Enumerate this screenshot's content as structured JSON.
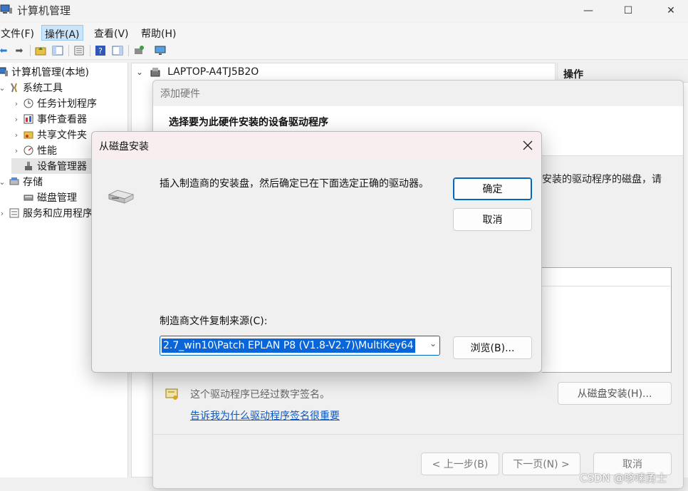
{
  "window": {
    "title": "计算机管理",
    "minimize": "—",
    "maximize": "☐",
    "close": "✕"
  },
  "menu": [
    "文件(F)",
    "操作(A)",
    "查看(V)",
    "帮助(H)"
  ],
  "toolbar_icons": [
    "back-arrow-icon",
    "forward-arrow-icon",
    "up-folder-icon",
    "show-hide-tree-icon",
    "properties-icon",
    "help-icon",
    "console-icon",
    "scan-hardware-icon",
    "monitor-icon"
  ],
  "tree": {
    "root": "计算机管理(本地)",
    "system_tools": "系统工具",
    "task_scheduler": "任务计划程序",
    "event_viewer": "事件查看器",
    "shared_folders": "共享文件夹",
    "performance": "性能",
    "device_manager": "设备管理器",
    "storage": "存储",
    "disk_management": "磁盘管理",
    "services_apps": "服务和应用程序"
  },
  "center": {
    "computer_name": "LAPTOP-A4TJ5B2O"
  },
  "right": {
    "actions_header": "操作"
  },
  "wizard": {
    "title": "添加硬件",
    "heading": "选择要为此硬件安装的设备驱动程序",
    "desc_fragment": "安装的驱动程序的磁盘，请",
    "signed_text": "这个驱动程序已经过数字签名。",
    "signed_link": "告诉我为什么驱动程序签名很重要",
    "have_disk": "从磁盘安装(H)...",
    "back": "< 上一步(B)",
    "next": "下一页(N) >",
    "cancel": "取消"
  },
  "dialog": {
    "title": "从磁盘安装",
    "instruction": "插入制造商的安装盘，然后确定已在下面选定正确的驱动器。",
    "ok": "确定",
    "cancel": "取消",
    "source_label": "制造商文件复制来源(C):",
    "source_value": "2.7_win10\\Patch EPLAN P8 (V1.8-V2.7)\\MultiKey64",
    "browse": "浏览(B)..."
  },
  "watermark": "CSDN @哆嗦勇士"
}
